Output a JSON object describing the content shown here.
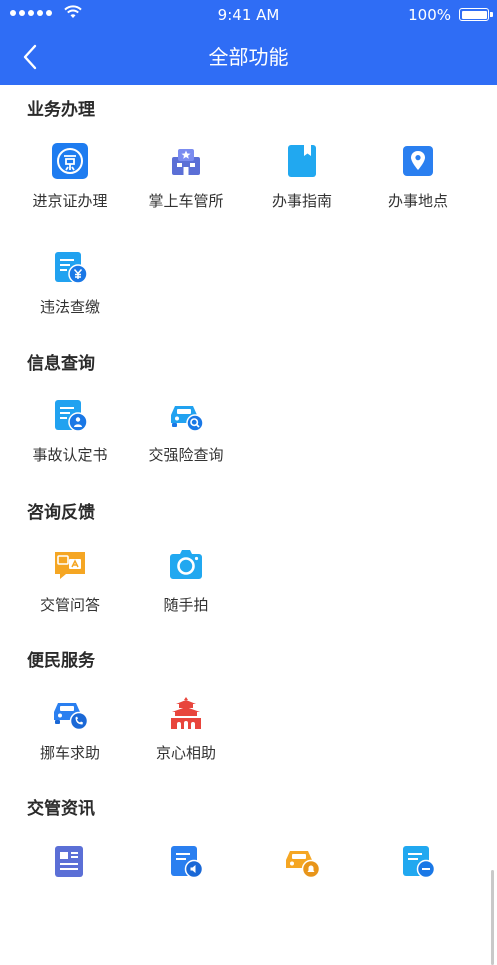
{
  "status_bar": {
    "time": "9:41 AM",
    "battery": "100%"
  },
  "nav": {
    "title": "全部功能"
  },
  "sections": [
    {
      "title": "业务办理",
      "items": [
        {
          "label": "进京证办理",
          "icon": "jing-permit-icon"
        },
        {
          "label": "掌上车管所",
          "icon": "vehicle-office-icon"
        },
        {
          "label": "办事指南",
          "icon": "guide-book-icon"
        },
        {
          "label": "办事地点",
          "icon": "location-pin-icon"
        },
        {
          "label": "违法查缴",
          "icon": "fine-payment-icon"
        }
      ]
    },
    {
      "title": "信息查询",
      "items": [
        {
          "label": "事故认定书",
          "icon": "accident-report-icon"
        },
        {
          "label": "交强险查询",
          "icon": "car-insurance-icon"
        }
      ]
    },
    {
      "title": "咨询反馈",
      "items": [
        {
          "label": "交管问答",
          "icon": "qa-chat-icon"
        },
        {
          "label": "随手拍",
          "icon": "camera-icon"
        }
      ]
    },
    {
      "title": "便民服务",
      "items": [
        {
          "label": "挪车求助",
          "icon": "move-car-phone-icon"
        },
        {
          "label": "京心相助",
          "icon": "tiananmen-icon"
        }
      ]
    },
    {
      "title": "交管资讯",
      "items": [
        {
          "label": "",
          "icon": "news-icon"
        },
        {
          "label": "",
          "icon": "announcement-icon"
        },
        {
          "label": "",
          "icon": "car-alert-icon"
        },
        {
          "label": "",
          "icon": "document-minus-icon"
        }
      ]
    }
  ],
  "colors": {
    "header": "#2f6df5",
    "icon_blue": "#1f8ef1",
    "icon_orange": "#f5a623",
    "icon_red": "#e8453c",
    "icon_purple": "#5b6fd6"
  }
}
